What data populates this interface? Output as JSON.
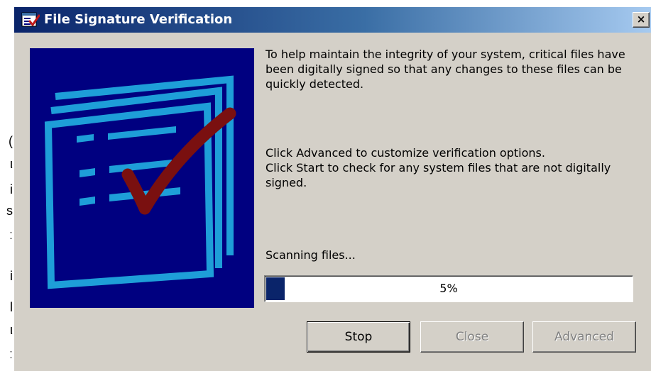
{
  "window": {
    "title": "File Signature Verification",
    "close_glyph": "×",
    "title_icon": "file-signature-app-icon",
    "close_icon": "close-icon"
  },
  "background_fragments": [
    "(",
    "ι",
    "i",
    "s",
    "ː",
    "i",
    "l",
    "ι",
    "ː"
  ],
  "illustration": {
    "name": "signed-document-with-checkmark-illustration",
    "background_color": "#000080",
    "document_color": "#1e9ed8",
    "check_color": "#7a1010"
  },
  "description": {
    "paragraph1": "To help maintain the integrity of your system, critical files have been digitally signed so that any changes to these files can be quickly detected.",
    "paragraph2_line1": "Click Advanced to customize verification options.",
    "paragraph2_line2": "Click Start to check for any system files that are not digitally signed."
  },
  "status": {
    "label": "Scanning files...",
    "progress_text": "5%",
    "progress_value": 0.05,
    "progress_color": "#0a246a"
  },
  "buttons": {
    "stop": "Stop",
    "close": "Close",
    "advanced": "Advanced"
  }
}
